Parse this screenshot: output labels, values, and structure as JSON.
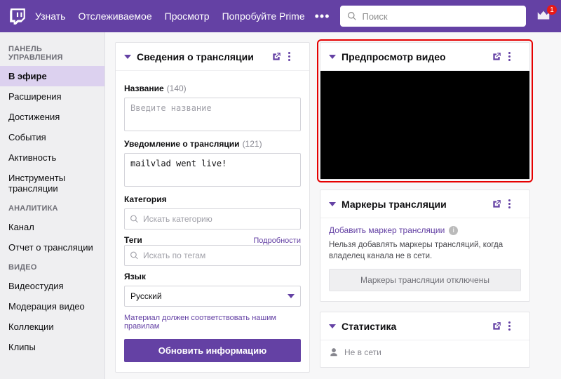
{
  "topbar": {
    "nav": [
      "Узнать",
      "Отслеживаемое",
      "Просмотр",
      "Попробуйте Prime"
    ],
    "search_placeholder": "Поиск",
    "prime_badge": "1"
  },
  "sidebar": {
    "groups": [
      {
        "title": "ПАНЕЛЬ УПРАВЛЕНИЯ",
        "items": [
          "В эфире",
          "Расширения",
          "Достижения",
          "События",
          "Активность",
          "Инструменты трансляции"
        ],
        "active_index": 0
      },
      {
        "title": "АНАЛИТИКА",
        "items": [
          "Канал",
          "Отчет о трансляции"
        ]
      },
      {
        "title": "ВИДЕО",
        "items": [
          "Видеостудия",
          "Модерация видео",
          "Коллекции",
          "Клипы"
        ]
      }
    ]
  },
  "stream_info": {
    "panel_title": "Сведения о трансляции",
    "name_label": "Название",
    "name_count": "(140)",
    "name_placeholder": "Введите название",
    "notif_label": "Уведомление о трансляции",
    "notif_count": "(121)",
    "notif_value": "mailvlad went live!",
    "category_label": "Категория",
    "category_placeholder": "Искать категорию",
    "tags_label": "Теги",
    "tags_details": "Подробности",
    "tags_placeholder": "Искать по тегам",
    "lang_label": "Язык",
    "lang_value": "Русский",
    "policy_note": "Материал должен соответствовать нашим правилам",
    "update_btn": "Обновить информацию"
  },
  "preview": {
    "panel_title": "Предпросмотр видео"
  },
  "markers": {
    "panel_title": "Маркеры трансляции",
    "add_marker": "Добавить маркер трансляции",
    "msg": "Нельзя добавлять маркеры трансляций, когда владелец канала не в сети.",
    "disabled_btn": "Маркеры трансляции отключены"
  },
  "stats": {
    "panel_title": "Статистика",
    "offline": "Не в сети",
    "offline2": "Не в сети"
  }
}
